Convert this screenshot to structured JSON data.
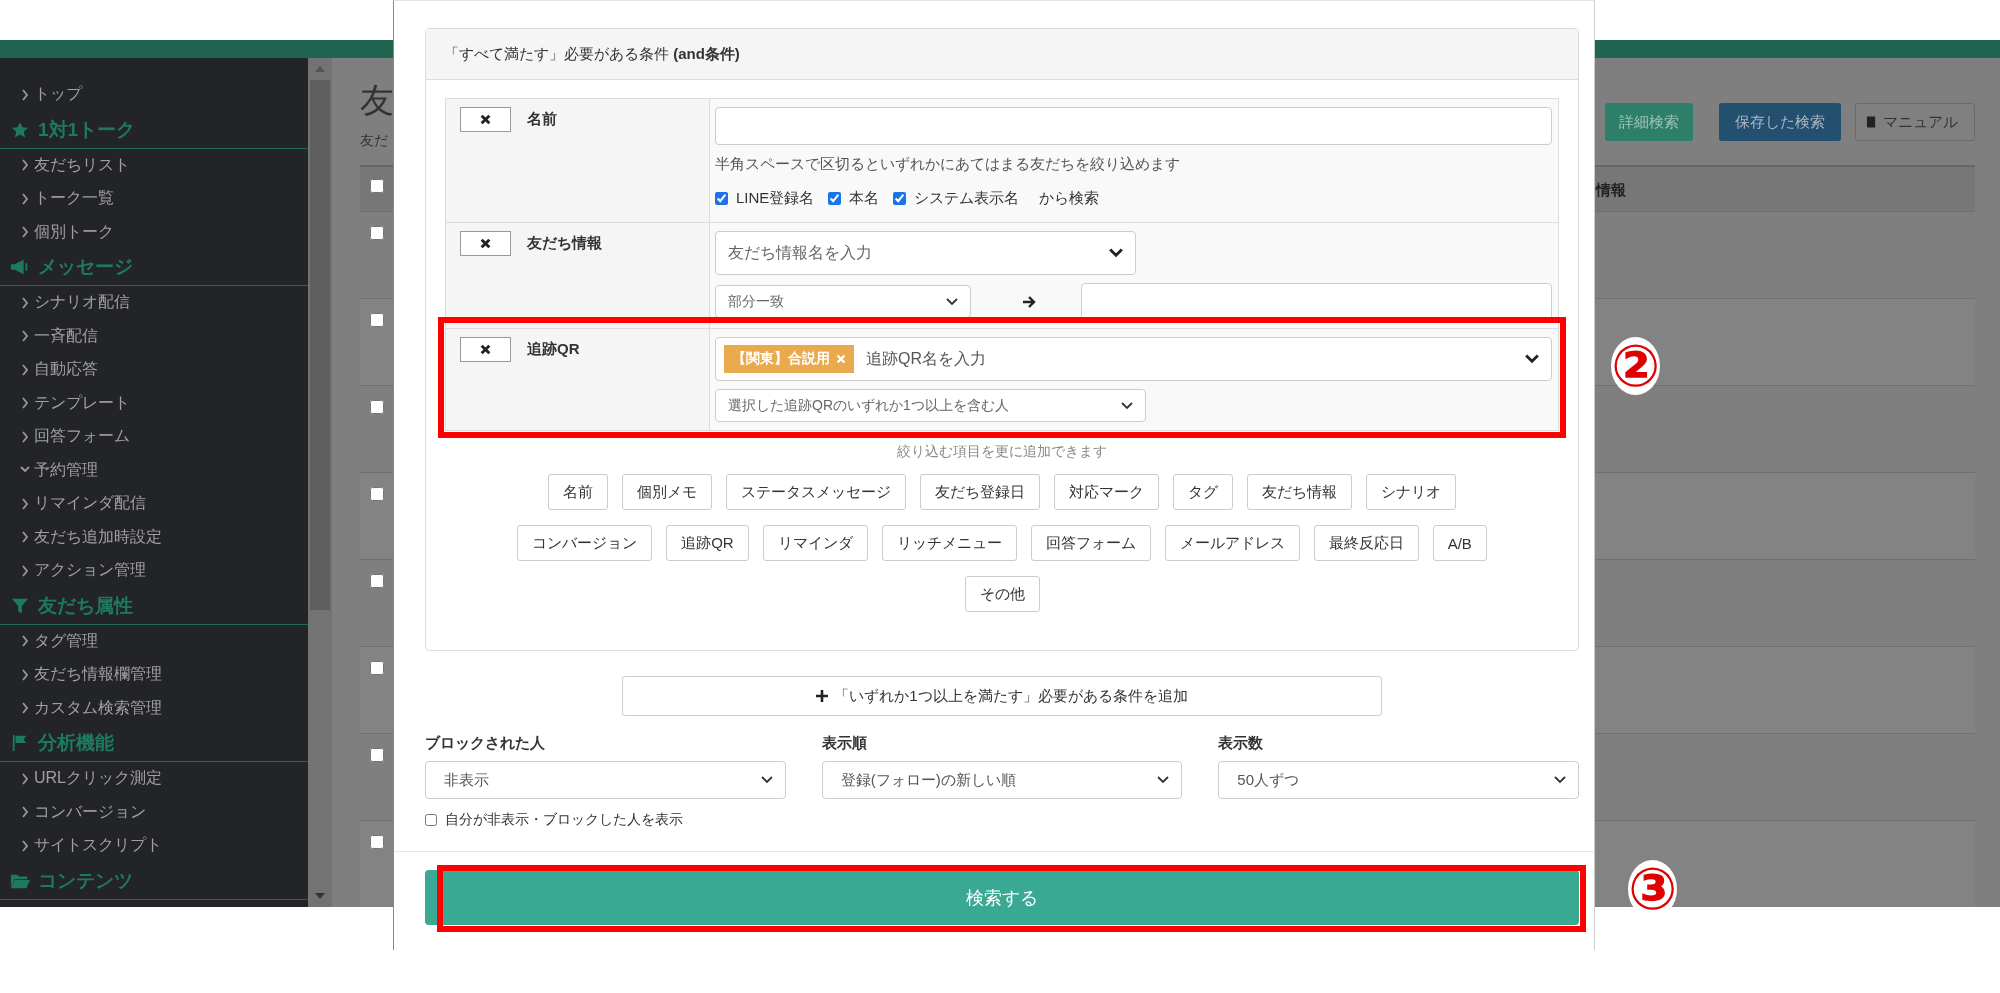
{
  "sidebar": {
    "items": [
      {
        "kind": "link",
        "label": "トップ",
        "expanded": false
      },
      {
        "kind": "heading",
        "label": "1対1トーク"
      },
      {
        "kind": "link",
        "label": "友だちリスト",
        "expanded": false
      },
      {
        "kind": "link",
        "label": "トーク一覧",
        "expanded": false
      },
      {
        "kind": "link",
        "label": "個別トーク",
        "expanded": false
      },
      {
        "kind": "heading",
        "label": "メッセージ"
      },
      {
        "kind": "link",
        "label": "シナリオ配信",
        "expanded": false
      },
      {
        "kind": "link",
        "label": "一斉配信",
        "expanded": false
      },
      {
        "kind": "link",
        "label": "自動応答",
        "expanded": false
      },
      {
        "kind": "link",
        "label": "テンプレート",
        "expanded": false
      },
      {
        "kind": "link",
        "label": "回答フォーム",
        "expanded": false
      },
      {
        "kind": "link",
        "label": "予約管理",
        "expanded": true
      },
      {
        "kind": "link",
        "label": "リマインダ配信",
        "expanded": false
      },
      {
        "kind": "link",
        "label": "友だち追加時設定",
        "expanded": false
      },
      {
        "kind": "link",
        "label": "アクション管理",
        "expanded": false
      },
      {
        "kind": "heading",
        "label": "友だち属性"
      },
      {
        "kind": "link",
        "label": "タグ管理",
        "expanded": false
      },
      {
        "kind": "link",
        "label": "友だち情報欄管理",
        "expanded": false
      },
      {
        "kind": "link",
        "label": "カスタム検索管理",
        "expanded": false
      },
      {
        "kind": "heading",
        "label": "分析機能"
      },
      {
        "kind": "link",
        "label": "URLクリック測定",
        "expanded": false
      },
      {
        "kind": "link",
        "label": "コンバージョン",
        "expanded": false
      },
      {
        "kind": "link",
        "label": "サイトスクリプト",
        "expanded": false
      },
      {
        "kind": "heading",
        "label": "コンテンツ"
      }
    ]
  },
  "page": {
    "title": "友",
    "subtitle": "友だ",
    "header_buttons": [
      {
        "label": "詳細検索",
        "kind": "teal"
      },
      {
        "label": "保存した検索",
        "kind": "blue"
      },
      {
        "label": "マニュアル",
        "kind": "manual"
      }
    ],
    "table": {
      "header_checked": false,
      "column_2": "情報",
      "rows": [
        {
          "checked": false
        },
        {
          "checked": false
        },
        {
          "checked": false
        },
        {
          "checked": false
        },
        {
          "checked": false
        },
        {
          "checked": false
        },
        {
          "checked": false
        },
        {
          "checked": false
        }
      ]
    }
  },
  "modal": {
    "and_panel": {
      "title": "「すべて満たす」必要がある条件 **(and条件)**",
      "conditions": [
        {
          "kind": "name",
          "label": "名前",
          "hint": "半角スペースで区切るといずれかにあてはまる友だちを絞り込めます",
          "targets": [
            {
              "label": "LINE登録名",
              "checked": true
            },
            {
              "label": "本名",
              "checked": true
            },
            {
              "label": "システム表示名",
              "checked": true
            }
          ],
          "targets_suffix": "から検索"
        },
        {
          "kind": "friend_info",
          "label": "友だち情報",
          "placeholder": "友だち情報名を入力",
          "match": "部分一致"
        },
        {
          "kind": "qr",
          "label": "追跡QR",
          "tags": [
            {
              "label": "【関東】合説用"
            }
          ],
          "placeholder": "追跡QR名を入力",
          "mode": "選択した追跡QRのいずれか1つ以上を含む人",
          "highlight_label": "②"
        }
      ],
      "add_hint": "絞り込む項目を更に追加できます",
      "add_buttons": [
        [
          "名前",
          "個別メモ",
          "ステータスメッセージ",
          "友だち登録日",
          "対応マーク",
          "タグ",
          "友だち情報",
          "シナリオ"
        ],
        [
          "コンバージョン",
          "追跡QR",
          "リマインダ",
          "リッチメニュー",
          "回答フォーム",
          "メールアドレス",
          "最終反応日",
          "A/B"
        ],
        [
          "その他"
        ]
      ]
    },
    "or_button": "「いずれか1つ以上を満たす」必要がある条件を追加",
    "options": [
      {
        "label": "ブロックされた人",
        "value": "非表示"
      },
      {
        "label": "表示順",
        "value": "登録(フォロー)の新しい順"
      },
      {
        "label": "表示数",
        "value": "50人ずつ"
      }
    ],
    "show_hidden": {
      "label": "自分が非表示・ブロックした人を表示",
      "checked": false
    },
    "search_button": {
      "label": "検索する",
      "highlight_label": "③"
    }
  }
}
